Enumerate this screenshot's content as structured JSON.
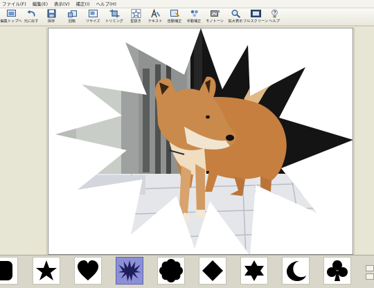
{
  "menubar": {
    "items": [
      "ファイル(F)",
      "編集(E)",
      "表示(V)",
      "補正(I)",
      "ヘルプ(H)"
    ]
  },
  "toolbar": {
    "buttons": [
      {
        "label": "編集トップへ",
        "icon": "edit-top-icon"
      },
      {
        "label": "元に戻す",
        "icon": "undo-icon"
      },
      {
        "label": "保存",
        "icon": "save-icon"
      },
      {
        "label": "回転",
        "icon": "rotate-icon"
      },
      {
        "label": "リサイズ",
        "icon": "resize-icon"
      },
      {
        "label": "トリミング",
        "icon": "trimming-icon"
      },
      {
        "label": "型抜き",
        "icon": "shape-cutout-icon"
      },
      {
        "label": "テキスト",
        "icon": "text-icon"
      },
      {
        "label": "自動補正",
        "icon": "auto-correct-icon"
      },
      {
        "label": "手動補正",
        "icon": "manual-correct-icon"
      },
      {
        "label": "モノトーン",
        "icon": "monotone-icon"
      },
      {
        "label": "拡大表示",
        "icon": "zoom-icon"
      },
      {
        "label": "フルスクリーン",
        "icon": "fullscreen-icon"
      },
      {
        "label": "ヘルプ",
        "icon": "help-icon"
      }
    ]
  },
  "canvas": {
    "content": "photo of a shiba dog cut out with a 12-point star mask"
  },
  "shape_tray": {
    "shapes": [
      {
        "name": "rounded-square",
        "selected": false
      },
      {
        "name": "star",
        "selected": false
      },
      {
        "name": "heart",
        "selected": false
      },
      {
        "name": "burst",
        "selected": true
      },
      {
        "name": "flower",
        "selected": false
      },
      {
        "name": "diamond",
        "selected": false
      },
      {
        "name": "six-point-star",
        "selected": false
      },
      {
        "name": "crescent-moon",
        "selected": false
      },
      {
        "name": "club",
        "selected": false
      }
    ],
    "selected_color": "#8b8fd6"
  }
}
